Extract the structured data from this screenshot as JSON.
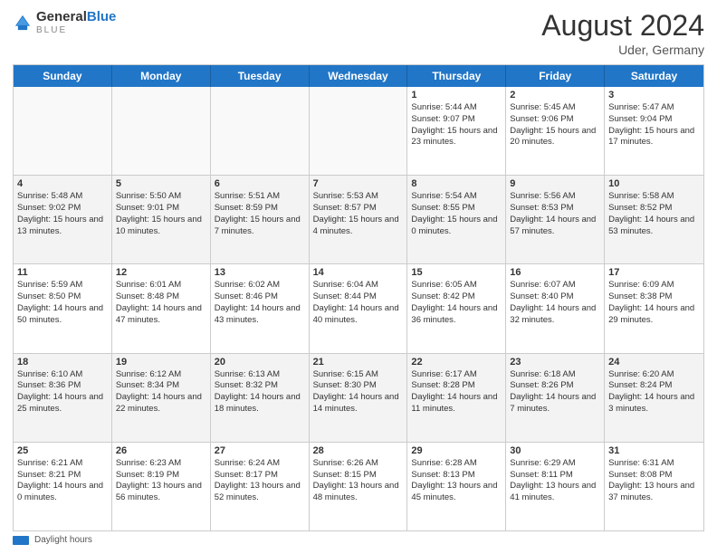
{
  "header": {
    "logo_general": "General",
    "logo_blue": "Blue",
    "month_title": "August 2024",
    "location": "Uder, Germany"
  },
  "days_of_week": [
    "Sunday",
    "Monday",
    "Tuesday",
    "Wednesday",
    "Thursday",
    "Friday",
    "Saturday"
  ],
  "rows": [
    [
      {
        "day": "",
        "sunrise": "",
        "sunset": "",
        "daylight": "",
        "empty": true
      },
      {
        "day": "",
        "sunrise": "",
        "sunset": "",
        "daylight": "",
        "empty": true
      },
      {
        "day": "",
        "sunrise": "",
        "sunset": "",
        "daylight": "",
        "empty": true
      },
      {
        "day": "",
        "sunrise": "",
        "sunset": "",
        "daylight": "",
        "empty": true
      },
      {
        "day": "1",
        "sunrise": "Sunrise: 5:44 AM",
        "sunset": "Sunset: 9:07 PM",
        "daylight": "Daylight: 15 hours and 23 minutes."
      },
      {
        "day": "2",
        "sunrise": "Sunrise: 5:45 AM",
        "sunset": "Sunset: 9:06 PM",
        "daylight": "Daylight: 15 hours and 20 minutes."
      },
      {
        "day": "3",
        "sunrise": "Sunrise: 5:47 AM",
        "sunset": "Sunset: 9:04 PM",
        "daylight": "Daylight: 15 hours and 17 minutes."
      }
    ],
    [
      {
        "day": "4",
        "sunrise": "Sunrise: 5:48 AM",
        "sunset": "Sunset: 9:02 PM",
        "daylight": "Daylight: 15 hours and 13 minutes."
      },
      {
        "day": "5",
        "sunrise": "Sunrise: 5:50 AM",
        "sunset": "Sunset: 9:01 PM",
        "daylight": "Daylight: 15 hours and 10 minutes."
      },
      {
        "day": "6",
        "sunrise": "Sunrise: 5:51 AM",
        "sunset": "Sunset: 8:59 PM",
        "daylight": "Daylight: 15 hours and 7 minutes."
      },
      {
        "day": "7",
        "sunrise": "Sunrise: 5:53 AM",
        "sunset": "Sunset: 8:57 PM",
        "daylight": "Daylight: 15 hours and 4 minutes."
      },
      {
        "day": "8",
        "sunrise": "Sunrise: 5:54 AM",
        "sunset": "Sunset: 8:55 PM",
        "daylight": "Daylight: 15 hours and 0 minutes."
      },
      {
        "day": "9",
        "sunrise": "Sunrise: 5:56 AM",
        "sunset": "Sunset: 8:53 PM",
        "daylight": "Daylight: 14 hours and 57 minutes."
      },
      {
        "day": "10",
        "sunrise": "Sunrise: 5:58 AM",
        "sunset": "Sunset: 8:52 PM",
        "daylight": "Daylight: 14 hours and 53 minutes."
      }
    ],
    [
      {
        "day": "11",
        "sunrise": "Sunrise: 5:59 AM",
        "sunset": "Sunset: 8:50 PM",
        "daylight": "Daylight: 14 hours and 50 minutes."
      },
      {
        "day": "12",
        "sunrise": "Sunrise: 6:01 AM",
        "sunset": "Sunset: 8:48 PM",
        "daylight": "Daylight: 14 hours and 47 minutes."
      },
      {
        "day": "13",
        "sunrise": "Sunrise: 6:02 AM",
        "sunset": "Sunset: 8:46 PM",
        "daylight": "Daylight: 14 hours and 43 minutes."
      },
      {
        "day": "14",
        "sunrise": "Sunrise: 6:04 AM",
        "sunset": "Sunset: 8:44 PM",
        "daylight": "Daylight: 14 hours and 40 minutes."
      },
      {
        "day": "15",
        "sunrise": "Sunrise: 6:05 AM",
        "sunset": "Sunset: 8:42 PM",
        "daylight": "Daylight: 14 hours and 36 minutes."
      },
      {
        "day": "16",
        "sunrise": "Sunrise: 6:07 AM",
        "sunset": "Sunset: 8:40 PM",
        "daylight": "Daylight: 14 hours and 32 minutes."
      },
      {
        "day": "17",
        "sunrise": "Sunrise: 6:09 AM",
        "sunset": "Sunset: 8:38 PM",
        "daylight": "Daylight: 14 hours and 29 minutes."
      }
    ],
    [
      {
        "day": "18",
        "sunrise": "Sunrise: 6:10 AM",
        "sunset": "Sunset: 8:36 PM",
        "daylight": "Daylight: 14 hours and 25 minutes."
      },
      {
        "day": "19",
        "sunrise": "Sunrise: 6:12 AM",
        "sunset": "Sunset: 8:34 PM",
        "daylight": "Daylight: 14 hours and 22 minutes."
      },
      {
        "day": "20",
        "sunrise": "Sunrise: 6:13 AM",
        "sunset": "Sunset: 8:32 PM",
        "daylight": "Daylight: 14 hours and 18 minutes."
      },
      {
        "day": "21",
        "sunrise": "Sunrise: 6:15 AM",
        "sunset": "Sunset: 8:30 PM",
        "daylight": "Daylight: 14 hours and 14 minutes."
      },
      {
        "day": "22",
        "sunrise": "Sunrise: 6:17 AM",
        "sunset": "Sunset: 8:28 PM",
        "daylight": "Daylight: 14 hours and 11 minutes."
      },
      {
        "day": "23",
        "sunrise": "Sunrise: 6:18 AM",
        "sunset": "Sunset: 8:26 PM",
        "daylight": "Daylight: 14 hours and 7 minutes."
      },
      {
        "day": "24",
        "sunrise": "Sunrise: 6:20 AM",
        "sunset": "Sunset: 8:24 PM",
        "daylight": "Daylight: 14 hours and 3 minutes."
      }
    ],
    [
      {
        "day": "25",
        "sunrise": "Sunrise: 6:21 AM",
        "sunset": "Sunset: 8:21 PM",
        "daylight": "Daylight: 14 hours and 0 minutes."
      },
      {
        "day": "26",
        "sunrise": "Sunrise: 6:23 AM",
        "sunset": "Sunset: 8:19 PM",
        "daylight": "Daylight: 13 hours and 56 minutes."
      },
      {
        "day": "27",
        "sunrise": "Sunrise: 6:24 AM",
        "sunset": "Sunset: 8:17 PM",
        "daylight": "Daylight: 13 hours and 52 minutes."
      },
      {
        "day": "28",
        "sunrise": "Sunrise: 6:26 AM",
        "sunset": "Sunset: 8:15 PM",
        "daylight": "Daylight: 13 hours and 48 minutes."
      },
      {
        "day": "29",
        "sunrise": "Sunrise: 6:28 AM",
        "sunset": "Sunset: 8:13 PM",
        "daylight": "Daylight: 13 hours and 45 minutes."
      },
      {
        "day": "30",
        "sunrise": "Sunrise: 6:29 AM",
        "sunset": "Sunset: 8:11 PM",
        "daylight": "Daylight: 13 hours and 41 minutes."
      },
      {
        "day": "31",
        "sunrise": "Sunrise: 6:31 AM",
        "sunset": "Sunset: 8:08 PM",
        "daylight": "Daylight: 13 hours and 37 minutes."
      }
    ]
  ],
  "footer": {
    "label": "Daylight hours"
  }
}
